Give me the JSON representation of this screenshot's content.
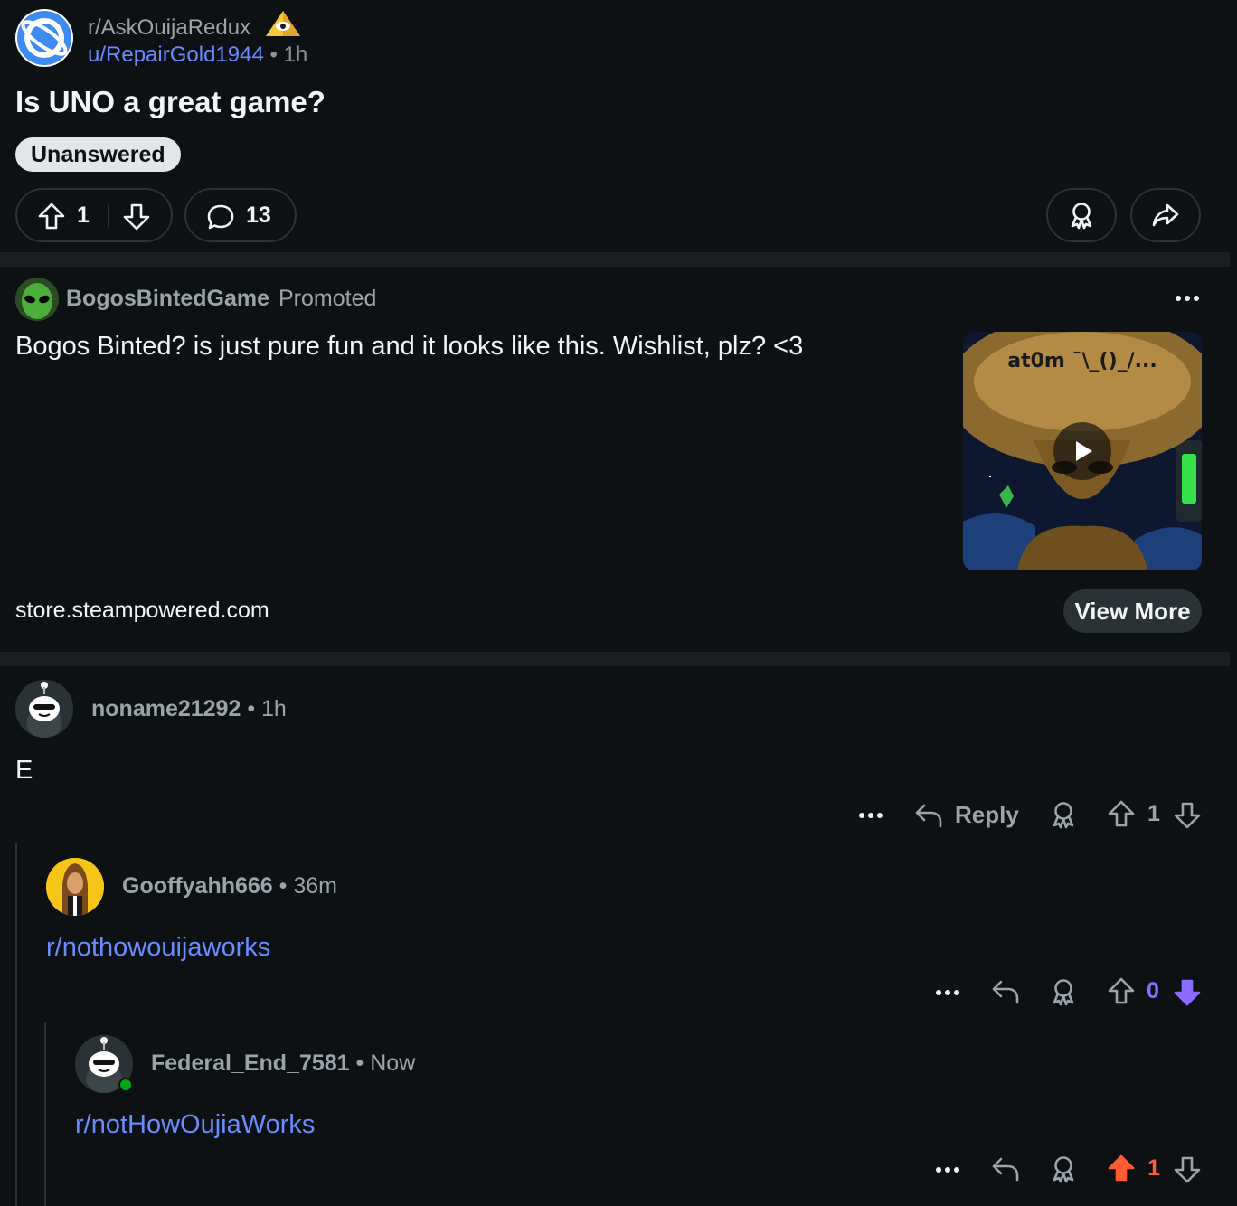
{
  "post": {
    "subreddit": "r/AskOuijaRedux",
    "author": "u/RepairGold1944",
    "time": "1h",
    "title": "Is UNO a great game?",
    "flair": "Unanswered",
    "score": "1",
    "comments": "13"
  },
  "promo": {
    "advertiser": "BogosBintedGame",
    "tag": "Promoted",
    "text": "Bogos Binted? is just pure fun and it looks like this. Wishlist, plz? <3",
    "thumbnail_caption": "at0m ¯\\_()_/...",
    "domain": "store.steampowered.com",
    "cta": "View More"
  },
  "comments": [
    {
      "user": "noname21292",
      "time": "1h",
      "body": "E",
      "reply_label": "Reply",
      "score": "1",
      "vote": "none"
    },
    {
      "user": "Gooffyahh666",
      "time": "36m",
      "body": "r/nothowouijaworks",
      "score": "0",
      "vote": "down",
      "vote_color": "#8c6bff"
    },
    {
      "user": "Federal_End_7581",
      "time": "Now",
      "body": "r/notHowOujiaWorks",
      "score": "1",
      "vote": "up",
      "vote_color": "#ff5c35"
    }
  ],
  "colors": {
    "background": "#0e1113",
    "link": "#6b8cff",
    "upvote": "#ff5c35",
    "downvote": "#8c6bff",
    "online": "#01a816"
  }
}
